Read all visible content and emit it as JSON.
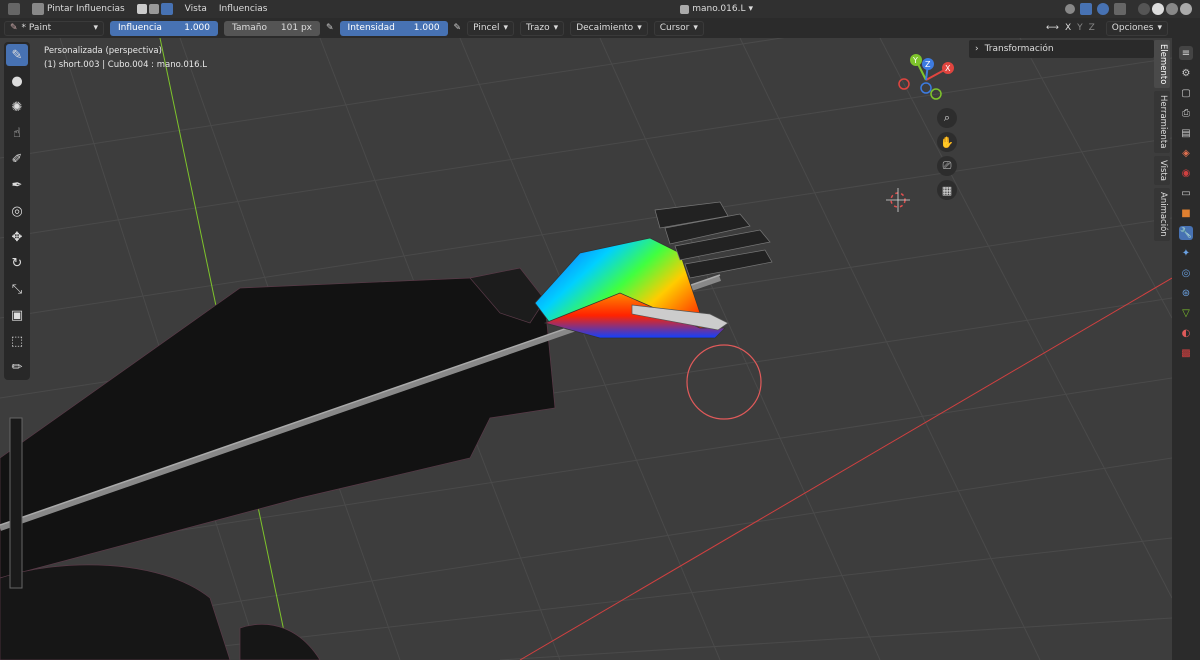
{
  "topbar": {
    "mode_label": "Pintar Influencias",
    "menus": [
      "Vista",
      "Influencias"
    ],
    "object_name": "mano.016.L"
  },
  "toolheader": {
    "brush": "* Paint",
    "influence_label": "Influencia",
    "influence_value": "1.000",
    "size_label": "Tamaño",
    "size_value": "101 px",
    "strength_label": "Intensidad",
    "strength_value": "1.000",
    "dropdowns": [
      "Pincel",
      "Trazo",
      "Decaimiento",
      "Cursor"
    ],
    "axis_labels": [
      "X",
      "Y",
      "Z"
    ],
    "options_label": "Opciones"
  },
  "viewport": {
    "view_name": "Personalizada (perspectiva)",
    "object_info": "(1) short.003 | Cubo.004 : mano.016.L",
    "gizmo": {
      "x": "X",
      "y": "Y",
      "z": "Z"
    }
  },
  "npanel": {
    "section": "Transformación",
    "tabs": [
      "Elemento",
      "Herramienta",
      "Vista",
      "Animación"
    ]
  },
  "colors": {
    "accent": "#4772b3",
    "x_axis": "#e0453f",
    "y_axis": "#7ec42b",
    "z_axis": "#3d7be0"
  }
}
